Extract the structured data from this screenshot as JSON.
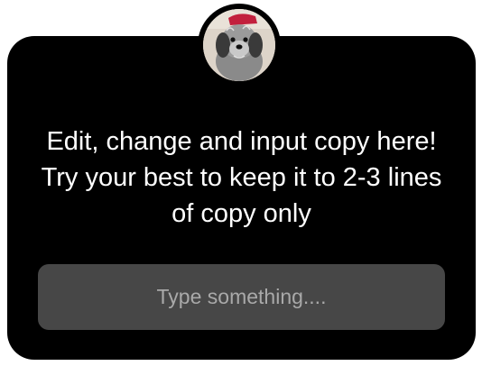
{
  "prompt_card": {
    "message": "Edit, change and input copy here! Try your best to keep it to 2-3 lines of copy only",
    "input": {
      "placeholder": "Type something...."
    },
    "avatar": {
      "icon": "dog-avatar-photo"
    }
  },
  "colors": {
    "card_background": "#000000",
    "input_background": "#474747",
    "text": "#ffffff",
    "placeholder": "#a9a9a9"
  }
}
